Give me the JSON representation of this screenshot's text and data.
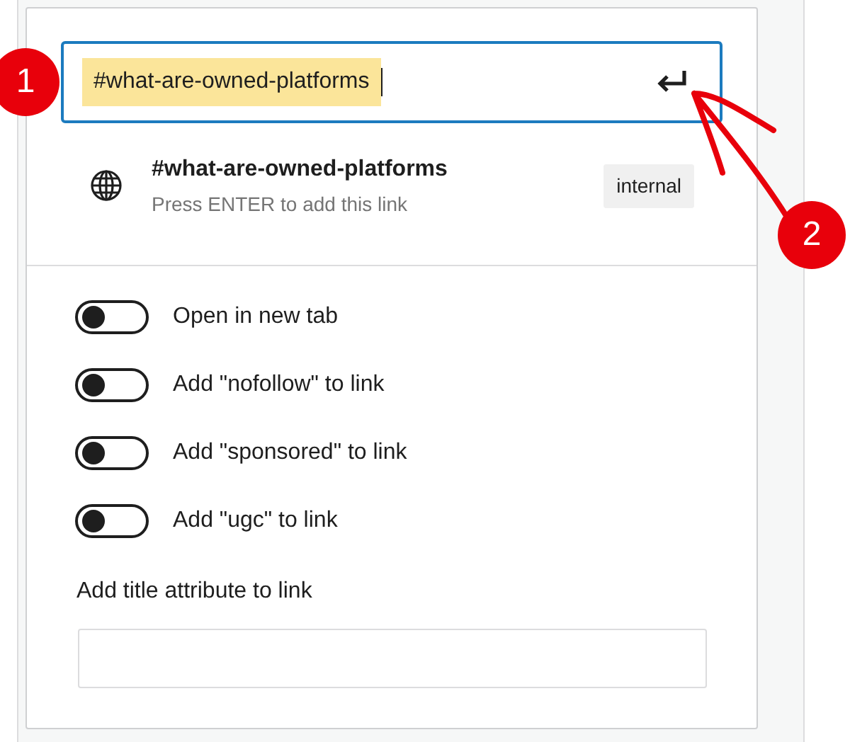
{
  "link_input": {
    "value": "#what-are-owned-platforms",
    "text_selected": true
  },
  "suggestion": {
    "title": "#what-are-owned-platforms",
    "hint": "Press ENTER to add this link",
    "badge": "internal"
  },
  "settings": [
    {
      "label": "Open in new tab",
      "checked": false
    },
    {
      "label": "Add \"nofollow\" to link",
      "checked": false
    },
    {
      "label": "Add \"sponsored\" to link",
      "checked": false
    },
    {
      "label": "Add \"ugc\" to link",
      "checked": false
    }
  ],
  "title_attribute": {
    "label": "Add title attribute to link"
  },
  "annotations": [
    {
      "label": "1"
    },
    {
      "label": "2"
    }
  ]
}
